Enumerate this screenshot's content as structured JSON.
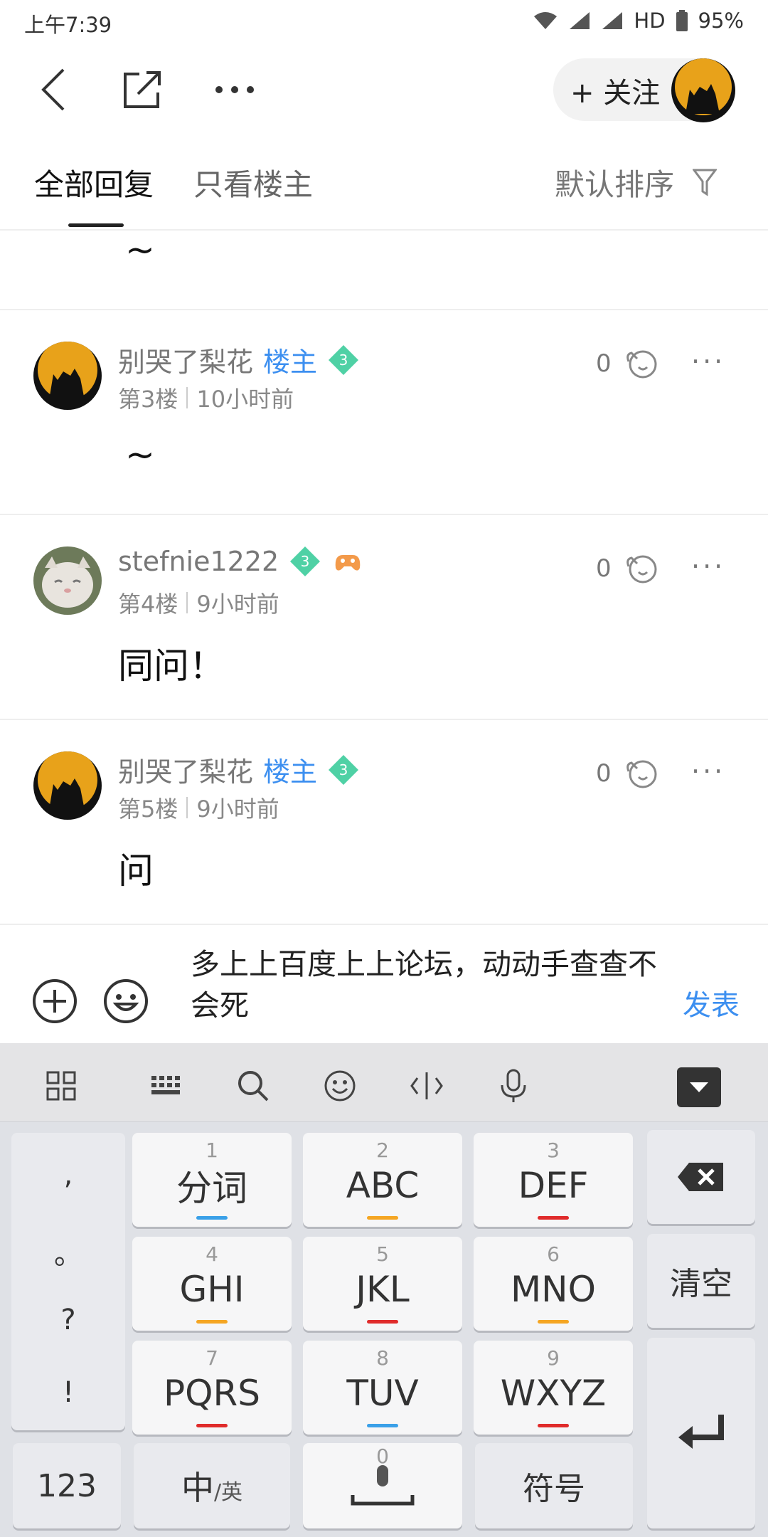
{
  "status_bar": {
    "time": "上午7:39",
    "network": "HD",
    "battery": "95%"
  },
  "header": {
    "follow_label": "+ 关注"
  },
  "tabs": {
    "all": "全部回复",
    "op_only": "只看楼主",
    "sort": "默认排序"
  },
  "thread": {
    "prev_post_tail": "~",
    "op_label": "楼主",
    "level_badge": "3",
    "posts": [
      {
        "author": "别哭了梨花",
        "is_op": true,
        "floor": "第3楼",
        "time": "10小时前",
        "likes": "0",
        "content": "~"
      },
      {
        "author": "stefnie1222",
        "is_op": false,
        "floor": "第4楼",
        "time": "9小时前",
        "likes": "0",
        "content": "同问！"
      },
      {
        "author": "别哭了梨花",
        "is_op": true,
        "floor": "第5楼",
        "time": "9小时前",
        "likes": "0",
        "content": "问"
      }
    ]
  },
  "composer": {
    "text": "多上上百度上上论坛，动动手查查不会死",
    "send_label": "发表"
  },
  "keyboard": {
    "punct": [
      ",",
      "。",
      "?",
      "!"
    ],
    "keys": [
      {
        "num": "1",
        "label": "分词",
        "bar": "#3aa0e8"
      },
      {
        "num": "2",
        "label": "ABC",
        "bar": "#f5a623"
      },
      {
        "num": "3",
        "label": "DEF",
        "bar": "#e02b2b"
      },
      {
        "num": "4",
        "label": "GHI",
        "bar": "#f5a623"
      },
      {
        "num": "5",
        "label": "JKL",
        "bar": "#e02b2b"
      },
      {
        "num": "6",
        "label": "MNO",
        "bar": "#f5a623"
      },
      {
        "num": "7",
        "label": "PQRS",
        "bar": "#e02b2b"
      },
      {
        "num": "8",
        "label": "TUV",
        "bar": "#3aa0e8"
      },
      {
        "num": "9",
        "label": "WXYZ",
        "bar": "#e02b2b"
      }
    ],
    "clear": "清空",
    "num_mode": "123",
    "lang_main": "中",
    "lang_alt": "/英",
    "space_num": "0",
    "symbols": "符号"
  },
  "colors": {
    "accent": "#3c8ff0",
    "badge": "#4fd1a5"
  }
}
